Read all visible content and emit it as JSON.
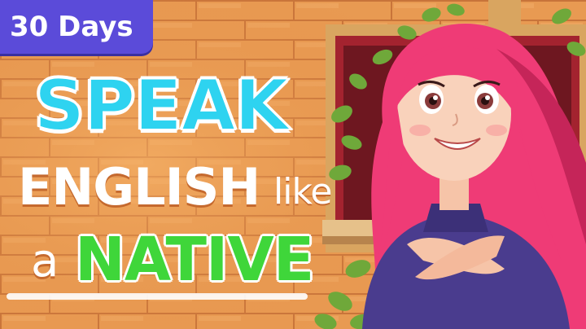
{
  "badge": {
    "text": "30 Days"
  },
  "headline": {
    "line1": "SPEAK",
    "line2_main": "ENGLISH",
    "line2_small": "like",
    "line3_small": "a",
    "line3_main": "NATIVE"
  },
  "colors": {
    "brick": "#e89a52",
    "mortar": "#c8743a",
    "badge_bg": "#5b4bd9",
    "speak": "#2ed3f0",
    "native": "#3fd63a",
    "hair": "#ef3b76",
    "sweater": "#4a3c8e"
  }
}
